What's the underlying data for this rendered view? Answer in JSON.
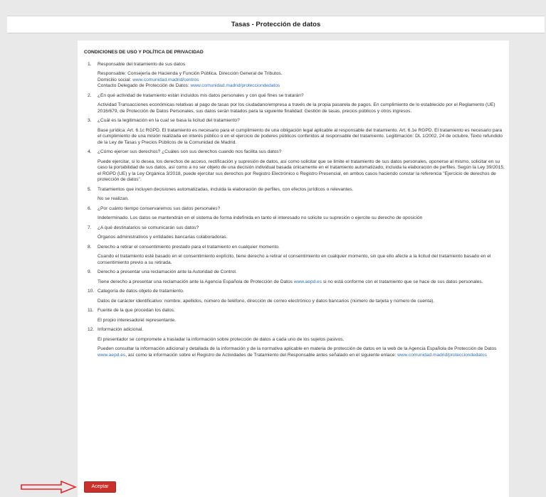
{
  "header": {
    "title": "Tasas - Protección de datos"
  },
  "doc": {
    "heading": "CONDICIONES DE USO Y POLÍTICA DE PRIVACIDAD",
    "items": [
      {
        "num": "1.",
        "title": "Responsable del tratamiento de sus datos",
        "paras": [
          {
            "l1": "Responsable: Consejería de Hacienda y Función Pública. Dirección General de Tributos.",
            "l2pre": "Domicilio social: ",
            "l2link": "www.comunidad.madrid/centros",
            "l3pre": "Contacto Delegado de Protección de Datos: ",
            "l3link": "www.comunidad.madrid/protecciondedatos"
          }
        ]
      },
      {
        "num": "2.",
        "title": "¿En qué actividad de tratamiento están incluidos mis datos personales y con qué fines se tratarán?",
        "text": "Actividad Transacciones económicas relativas al pago de tasas por los ciudadano/empresa a través de la propia pasarela de pagos. En cumplimiento de lo establecido por el Reglamento (UE) 2016/679, de Protección de Datos Personales, sus datos serán tratados para la siguiente finalidad: Gestión de tasas, precios públicos y otros ingresos."
      },
      {
        "num": "3.",
        "title": "¿Cuál es la legitimación en la cual se basa la licitud del tratamiento?",
        "text": "Base jurídica: Art. 6.1c RGPD. El tratamiento es necesario para el cumplimiento de una obligación legal aplicable al responsable del tratamiento. Art. 6.1e RGPD. El tratamiento es necesario para el cumplimiento de una misión realizada en interés público o en el ejercicio de poderes públicos conferidos al responsable del tratamiento. Legitimación: DL 1/2002, 24 de octubre, Texto refundido de la Ley de Tasas y Precios Públicos de la Comunidad de Madrid."
      },
      {
        "num": "4.",
        "title": "¿Cómo ejercer sus derechos? ¿Cuáles son sus derechos cuando nos facilita sus datos?",
        "text": "Puede ejercitar, si lo desea, los derechos de acceso, rectificación y supresión de datos, así como solicitar que se limite el tratamiento de sus datos personales, oponerse al mismo, solicitar en su caso la portabilidad de sus datos, así como a no ser objeto de una decisión individual basada únicamente en el tratamiento automatizado, incluida la elaboración de perfiles. Según la Ley 39/2015, el RGPD (UE) y la Ley Orgánica 3/2018, puede ejercitar sus derechos por Registro Electrónico o Registro Presencial, en ambos casos haciendo constar la referencia \"Ejercicio de derechos de protección de datos\"."
      },
      {
        "num": "5.",
        "title": "Tratamientos que incluyen decisiones automatizadas, incluida la elaboración de perfiles, con efectos jurídicos o relevantes.",
        "text": "No se realizan."
      },
      {
        "num": "6.",
        "title": "¿Por cuánto tiempo conservaremos sus datos personales?",
        "text": "Indeterminado. Los datos se mantendrán en el sistema de forma indefinida en tanto el interesado no solicite su supresión o ejercite su derecho de oposición"
      },
      {
        "num": "7.",
        "title": "¿A qué destinatarios se comunicarán sus datos?",
        "text": "Órganos administrativos y entidades bancarias colaboradoras."
      },
      {
        "num": "8.",
        "title": "Derecho a retirar el consentimiento prestado para el tratamiento en cualquier momento.",
        "text": "Cuando el tratamiento esté basado en el consentimiento explícito, tiene derecho a retirar el consentimiento en cualquier momento, sin que ello afecte a la licitud del tratamiento basado en el consentimiento previo a su retirada."
      },
      {
        "num": "9.",
        "title": "Derecho a presentar una reclamación ante la Autoridad de Control.",
        "pre": "Tiene derecho a presentar una reclamación ante la Agencia Española de Protección de Datos ",
        "link": "www.aepd.es",
        "post": " si no está conforme con el tratamiento que se hace de sus datos personales."
      },
      {
        "num": "10.",
        "title": "Categoría de datos objeto de tratamiento.",
        "text": "Datos de carácter identificativo: nombre, apellidos, número de teléfono, dirección de correo electrónico y datos bancarios (número de tarjeta y número de cuenta)."
      },
      {
        "num": "11.",
        "title": "Fuente de la que procedan los datos.",
        "text": "El propio interesado/el representante."
      },
      {
        "num": "12.",
        "title": "Información adicional.",
        "text": "El presentador se compromete a trasladar la información sobre protección de datos a cada uno de los sujetos pasivos.",
        "pre": "Pueden consultar la información adicional y detallada de la información y de la normativa aplicable en materia de protección de datos en la web de la Agencia Española de Protección de Datos ",
        "link": "www.aepd.es",
        "mid": ", así como la información sobre el Registro de Actividades de Tratamiento del Responsable antes señalado en el siguiente enlace: ",
        "link2": "www.comunidad.madrid/protecciondedatos"
      }
    ]
  },
  "accept_button": "Aceptar",
  "colors": {
    "accent": "#c9302c",
    "link": "#2f6fb6",
    "arrow": "#e8222a"
  }
}
